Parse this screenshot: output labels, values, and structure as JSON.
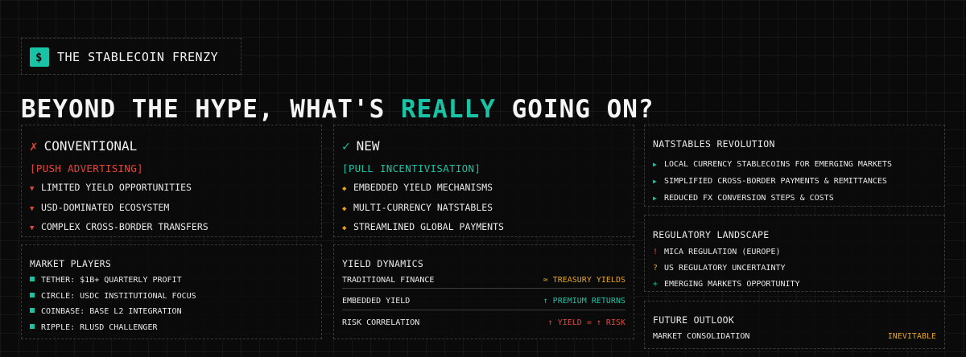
{
  "brand": {
    "icon_glyph": "$",
    "title": "THE STABLECOIN FRENZY"
  },
  "headline": {
    "before": "BEYOND THE HYPE, WHAT'S ",
    "accent": "REALLY",
    "after": " GOING ON?",
    "accent_color": "#19c3a6"
  },
  "conventional": {
    "marker": "✗",
    "title": "CONVENTIONAL",
    "tag": "[PUSH ADVERTISING]",
    "bullet": "▼",
    "items": [
      "LIMITED YIELD OPPORTUNITIES",
      "USD-DOMINATED ECOSYSTEM",
      "COMPLEX CROSS-BORDER TRANSFERS"
    ]
  },
  "new": {
    "marker": "✓",
    "title": "NEW",
    "tag": "[PULL INCENTIVISATION]",
    "bullet": "◆",
    "items": [
      "EMBEDDED YIELD MECHANISMS",
      "MULTI-CURRENCY NATSTABLES",
      "STREAMLINED GLOBAL PAYMENTS"
    ]
  },
  "natstables": {
    "title": "NATSTABLES REVOLUTION",
    "bullet": "▶",
    "items": [
      "LOCAL CURRENCY STABLECOINS FOR EMERGING MARKETS",
      "SIMPLIFIED CROSS-BORDER PAYMENTS & REMITTANCES",
      "REDUCED FX CONVERSION STEPS & COSTS"
    ]
  },
  "market_players": {
    "title": "MARKET PLAYERS",
    "items": [
      "TETHER: $1B+ QUARTERLY PROFIT",
      "CIRCLE: USDC INSTITUTIONAL FOCUS",
      "COINBASE: BASE L2 INTEGRATION",
      "RIPPLE: RLUSD CHALLENGER"
    ]
  },
  "yield_dynamics": {
    "title": "YIELD DYNAMICS",
    "rows": [
      {
        "label": "TRADITIONAL FINANCE",
        "value": "≈ TREASURY YIELDS"
      },
      {
        "label": "EMBEDDED YIELD",
        "value": "↑ PREMIUM RETURNS"
      },
      {
        "label": "RISK CORRELATION",
        "value": "↑ YIELD = ↑ RISK"
      }
    ]
  },
  "regulatory": {
    "title": "REGULATORY LANDSCAPE",
    "items": [
      {
        "symbol": "!",
        "text": "MICA REGULATION (EUROPE)"
      },
      {
        "symbol": "?",
        "text": "US REGULATORY UNCERTAINTY"
      },
      {
        "symbol": "+",
        "text": "EMERGING MARKETS OPPORTUNITY"
      }
    ]
  },
  "future": {
    "title": "FUTURE OUTLOOK",
    "label": "MARKET CONSOLIDATION",
    "value": "INEVITABLE"
  }
}
